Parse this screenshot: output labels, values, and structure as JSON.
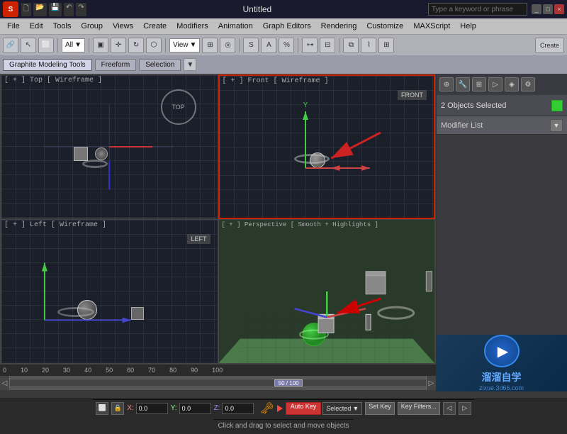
{
  "titlebar": {
    "app_name": "S",
    "title": "Untitled",
    "window_controls": [
      "_",
      "□",
      "×"
    ]
  },
  "menubar": {
    "items": [
      "File",
      "Edit",
      "Tools",
      "Group",
      "Views",
      "Create",
      "Modifiers",
      "Animation",
      "Graph Editors",
      "Rendering",
      "Customize",
      "MAXScript",
      "Help"
    ]
  },
  "toolbar": {
    "dropdown_value": "All",
    "create_label": "Create"
  },
  "subtoolbar": {
    "graphite_label": "Graphite Modeling Tools",
    "freeform_label": "Freeform",
    "selection_label": "Selection",
    "arrow_label": "▼"
  },
  "viewports": {
    "top": {
      "label": "[ + ] Top [ Wireframe ]"
    },
    "front": {
      "label": "[ + ] Front [ Wireframe ]"
    },
    "left": {
      "label": "[ + ] Left [ Wireframe ]"
    },
    "perspective": {
      "label": "[ + ] Perspective [ Smooth + Highlights ]"
    }
  },
  "rightpanel": {
    "objects_selected": "2 Objects Selected",
    "modifier_list": "Modifier List"
  },
  "timeline": {
    "position": "50 / 100",
    "ticks": [
      "0",
      "10",
      "20",
      "30",
      "40",
      "50",
      "60",
      "70",
      "80",
      "90",
      "100"
    ]
  },
  "statusbar": {
    "coord_x_label": "X:",
    "coord_x_value": "0.0",
    "coord_y_label": "Y:",
    "coord_y_value": "0.0",
    "coord_z_label": "Z:",
    "coord_z_value": "0.0",
    "auto_key_label": "Auto Key",
    "selected_label": "Selected",
    "set_key_label": "Set Key",
    "key_filters_label": "Key Filters...",
    "prompt": "Click and drag to select and move objects"
  }
}
